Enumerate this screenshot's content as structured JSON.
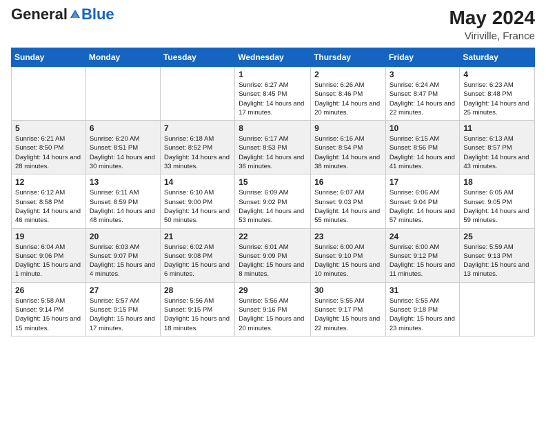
{
  "header": {
    "logo_general": "General",
    "logo_blue": "Blue",
    "month": "May 2024",
    "location": "Viriville, France"
  },
  "weekdays": [
    "Sunday",
    "Monday",
    "Tuesday",
    "Wednesday",
    "Thursday",
    "Friday",
    "Saturday"
  ],
  "weeks": [
    [
      {
        "day": "",
        "sunrise": "",
        "sunset": "",
        "daylight": ""
      },
      {
        "day": "",
        "sunrise": "",
        "sunset": "",
        "daylight": ""
      },
      {
        "day": "",
        "sunrise": "",
        "sunset": "",
        "daylight": ""
      },
      {
        "day": "1",
        "sunrise": "Sunrise: 6:27 AM",
        "sunset": "Sunset: 8:45 PM",
        "daylight": "Daylight: 14 hours and 17 minutes."
      },
      {
        "day": "2",
        "sunrise": "Sunrise: 6:26 AM",
        "sunset": "Sunset: 8:46 PM",
        "daylight": "Daylight: 14 hours and 20 minutes."
      },
      {
        "day": "3",
        "sunrise": "Sunrise: 6:24 AM",
        "sunset": "Sunset: 8:47 PM",
        "daylight": "Daylight: 14 hours and 22 minutes."
      },
      {
        "day": "4",
        "sunrise": "Sunrise: 6:23 AM",
        "sunset": "Sunset: 8:48 PM",
        "daylight": "Daylight: 14 hours and 25 minutes."
      }
    ],
    [
      {
        "day": "5",
        "sunrise": "Sunrise: 6:21 AM",
        "sunset": "Sunset: 8:50 PM",
        "daylight": "Daylight: 14 hours and 28 minutes."
      },
      {
        "day": "6",
        "sunrise": "Sunrise: 6:20 AM",
        "sunset": "Sunset: 8:51 PM",
        "daylight": "Daylight: 14 hours and 30 minutes."
      },
      {
        "day": "7",
        "sunrise": "Sunrise: 6:18 AM",
        "sunset": "Sunset: 8:52 PM",
        "daylight": "Daylight: 14 hours and 33 minutes."
      },
      {
        "day": "8",
        "sunrise": "Sunrise: 6:17 AM",
        "sunset": "Sunset: 8:53 PM",
        "daylight": "Daylight: 14 hours and 36 minutes."
      },
      {
        "day": "9",
        "sunrise": "Sunrise: 6:16 AM",
        "sunset": "Sunset: 8:54 PM",
        "daylight": "Daylight: 14 hours and 38 minutes."
      },
      {
        "day": "10",
        "sunrise": "Sunrise: 6:15 AM",
        "sunset": "Sunset: 8:56 PM",
        "daylight": "Daylight: 14 hours and 41 minutes."
      },
      {
        "day": "11",
        "sunrise": "Sunrise: 6:13 AM",
        "sunset": "Sunset: 8:57 PM",
        "daylight": "Daylight: 14 hours and 43 minutes."
      }
    ],
    [
      {
        "day": "12",
        "sunrise": "Sunrise: 6:12 AM",
        "sunset": "Sunset: 8:58 PM",
        "daylight": "Daylight: 14 hours and 46 minutes."
      },
      {
        "day": "13",
        "sunrise": "Sunrise: 6:11 AM",
        "sunset": "Sunset: 8:59 PM",
        "daylight": "Daylight: 14 hours and 48 minutes."
      },
      {
        "day": "14",
        "sunrise": "Sunrise: 6:10 AM",
        "sunset": "Sunset: 9:00 PM",
        "daylight": "Daylight: 14 hours and 50 minutes."
      },
      {
        "day": "15",
        "sunrise": "Sunrise: 6:09 AM",
        "sunset": "Sunset: 9:02 PM",
        "daylight": "Daylight: 14 hours and 53 minutes."
      },
      {
        "day": "16",
        "sunrise": "Sunrise: 6:07 AM",
        "sunset": "Sunset: 9:03 PM",
        "daylight": "Daylight: 14 hours and 55 minutes."
      },
      {
        "day": "17",
        "sunrise": "Sunrise: 6:06 AM",
        "sunset": "Sunset: 9:04 PM",
        "daylight": "Daylight: 14 hours and 57 minutes."
      },
      {
        "day": "18",
        "sunrise": "Sunrise: 6:05 AM",
        "sunset": "Sunset: 9:05 PM",
        "daylight": "Daylight: 14 hours and 59 minutes."
      }
    ],
    [
      {
        "day": "19",
        "sunrise": "Sunrise: 6:04 AM",
        "sunset": "Sunset: 9:06 PM",
        "daylight": "Daylight: 15 hours and 1 minute."
      },
      {
        "day": "20",
        "sunrise": "Sunrise: 6:03 AM",
        "sunset": "Sunset: 9:07 PM",
        "daylight": "Daylight: 15 hours and 4 minutes."
      },
      {
        "day": "21",
        "sunrise": "Sunrise: 6:02 AM",
        "sunset": "Sunset: 9:08 PM",
        "daylight": "Daylight: 15 hours and 6 minutes."
      },
      {
        "day": "22",
        "sunrise": "Sunrise: 6:01 AM",
        "sunset": "Sunset: 9:09 PM",
        "daylight": "Daylight: 15 hours and 8 minutes."
      },
      {
        "day": "23",
        "sunrise": "Sunrise: 6:00 AM",
        "sunset": "Sunset: 9:10 PM",
        "daylight": "Daylight: 15 hours and 10 minutes."
      },
      {
        "day": "24",
        "sunrise": "Sunrise: 6:00 AM",
        "sunset": "Sunset: 9:12 PM",
        "daylight": "Daylight: 15 hours and 11 minutes."
      },
      {
        "day": "25",
        "sunrise": "Sunrise: 5:59 AM",
        "sunset": "Sunset: 9:13 PM",
        "daylight": "Daylight: 15 hours and 13 minutes."
      }
    ],
    [
      {
        "day": "26",
        "sunrise": "Sunrise: 5:58 AM",
        "sunset": "Sunset: 9:14 PM",
        "daylight": "Daylight: 15 hours and 15 minutes."
      },
      {
        "day": "27",
        "sunrise": "Sunrise: 5:57 AM",
        "sunset": "Sunset: 9:15 PM",
        "daylight": "Daylight: 15 hours and 17 minutes."
      },
      {
        "day": "28",
        "sunrise": "Sunrise: 5:56 AM",
        "sunset": "Sunset: 9:15 PM",
        "daylight": "Daylight: 15 hours and 18 minutes."
      },
      {
        "day": "29",
        "sunrise": "Sunrise: 5:56 AM",
        "sunset": "Sunset: 9:16 PM",
        "daylight": "Daylight: 15 hours and 20 minutes."
      },
      {
        "day": "30",
        "sunrise": "Sunrise: 5:55 AM",
        "sunset": "Sunset: 9:17 PM",
        "daylight": "Daylight: 15 hours and 22 minutes."
      },
      {
        "day": "31",
        "sunrise": "Sunrise: 5:55 AM",
        "sunset": "Sunset: 9:18 PM",
        "daylight": "Daylight: 15 hours and 23 minutes."
      },
      {
        "day": "",
        "sunrise": "",
        "sunset": "",
        "daylight": ""
      }
    ]
  ]
}
